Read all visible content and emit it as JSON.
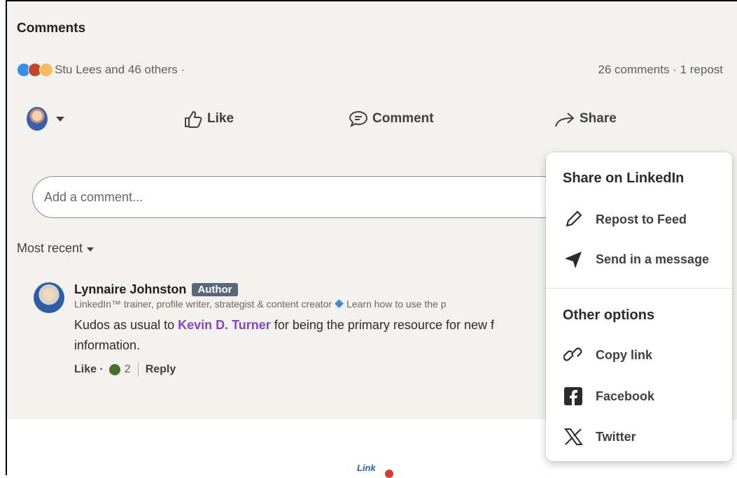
{
  "section": {
    "title": "Comments"
  },
  "social": {
    "reactors_text": "Stu Lees and 46 others ·",
    "counts_text": "26 comments · 1 repost"
  },
  "actions": {
    "like_label": "Like",
    "comment_label": "Comment",
    "share_label": "Share"
  },
  "composer": {
    "placeholder": "Add a comment..."
  },
  "sort": {
    "label": "Most recent"
  },
  "comment": {
    "author": "Lynnaire Johnston",
    "badge": "Author",
    "headline": "LinkedIn™ trainer, profile writer, strategist & content creator",
    "headline_tail": "Learn how to use the p",
    "text_before": "Kudos as usual to",
    "mention": "Kevin D. Turner",
    "text_after": "for being the primary resource for new f",
    "text_line2": "information.",
    "like_label": "Like ·",
    "reaction_count": "2",
    "reply_label": "Reply"
  },
  "share_menu": {
    "heading_linkedin": "Share on LinkedIn",
    "repost": "Repost to Feed",
    "send": "Send in a message",
    "heading_other": "Other options",
    "copy_link": "Copy link",
    "facebook": "Facebook",
    "twitter": "Twitter"
  },
  "footer_logo": {
    "text": "Link"
  },
  "colors": {
    "mention": "#8344cc",
    "badge": "#56687a",
    "card_bg": "#f4f2ee"
  }
}
